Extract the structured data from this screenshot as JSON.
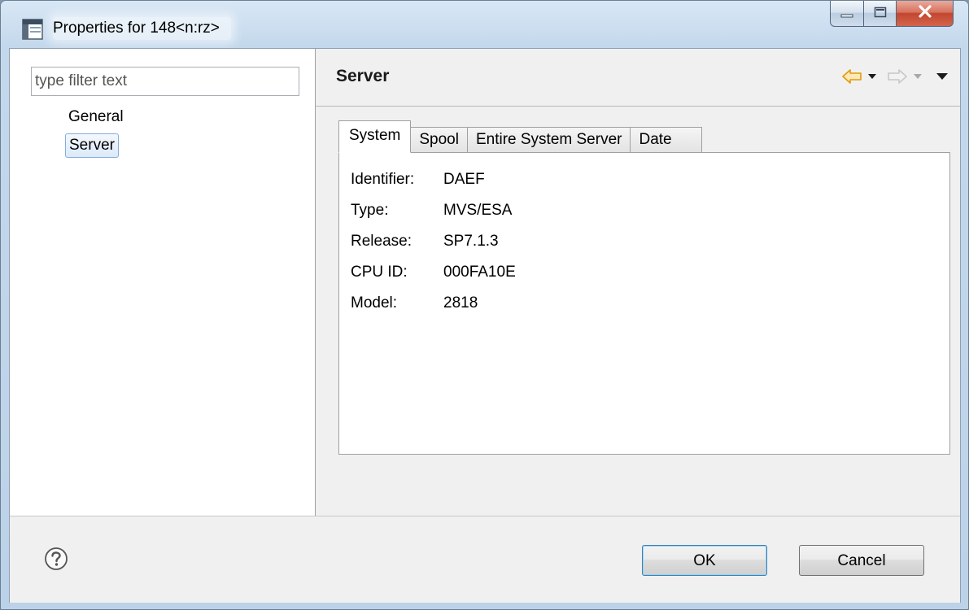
{
  "window": {
    "title": "Properties for 148<n:rz>"
  },
  "left_pane": {
    "filter_placeholder": "type filter text",
    "items": [
      {
        "label": "General",
        "selected": false
      },
      {
        "label": "Server",
        "selected": true
      }
    ]
  },
  "page": {
    "title": "Server",
    "nav_icons": [
      "back-arrow-icon",
      "back-dropdown-icon",
      "forward-arrow-icon",
      "forward-dropdown-icon",
      "view-menu-icon"
    ]
  },
  "tabs": [
    {
      "label": "System",
      "active": true
    },
    {
      "label": "Spool",
      "active": false
    },
    {
      "label": "Entire System Server",
      "active": false
    },
    {
      "label": "Date",
      "active": false
    }
  ],
  "system": {
    "rows": [
      {
        "label": "Identifier:",
        "value": "DAEF"
      },
      {
        "label": "Type:",
        "value": "MVS/ESA"
      },
      {
        "label": "Release:",
        "value": "SP7.1.3"
      },
      {
        "label": "CPU ID:",
        "value": "000FA10E"
      },
      {
        "label": "Model:",
        "value": "2818"
      }
    ]
  },
  "footer": {
    "ok_label": "OK",
    "cancel_label": "Cancel"
  },
  "colors": {
    "accent_arrow": "#f0a30a",
    "selection_border": "#84acdd",
    "close_button": "#c24630"
  }
}
